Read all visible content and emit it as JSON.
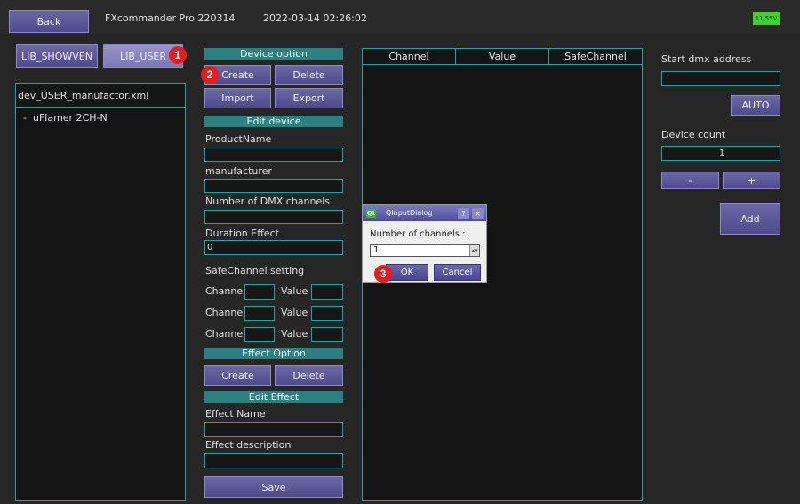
{
  "header": {
    "back": "Back",
    "app_title": "FXcommander Pro 220314",
    "datetime": "2022-03-14 02:26:02",
    "battery": "11.55V"
  },
  "left": {
    "tabs": [
      "LIB_SHOWVEN",
      "LIB_USER"
    ],
    "file": "dev_USER_manufactor.xml",
    "tree_items": [
      "uFlamer 2CH-N"
    ]
  },
  "device_option": {
    "header": "Device option",
    "create": "Create",
    "delete": "Delete",
    "import": "Import",
    "export": "Export"
  },
  "edit_device": {
    "header": "Edit device",
    "product_name_label": "ProductName",
    "product_name": "",
    "manufacturer_label": "manufacturer",
    "manufacturer": "",
    "dmx_channels_label": "Number of DMX channels",
    "dmx_channels": "",
    "duration_label": "Duration Effect",
    "duration": "0",
    "safe_label": "SafeChannel setting",
    "channel_label": "Channel",
    "value_label": "Value"
  },
  "effect_option": {
    "header": "Effect Option",
    "create": "Create",
    "delete": "Delete"
  },
  "edit_effect": {
    "header": "Edit Effect",
    "name_label": "Effect Name",
    "desc_label": "Effect description",
    "save": "Save"
  },
  "table": {
    "columns": [
      "Channel",
      "Value",
      "SafeChannel"
    ]
  },
  "right": {
    "start_label": "Start dmx address",
    "start_value": "",
    "auto": "AUTO",
    "count_label": "Device count",
    "count_value": "1",
    "minus": "-",
    "plus": "+",
    "add": "Add"
  },
  "dialog": {
    "title": "QInputDialog",
    "prompt": "Number of channels :",
    "value": "1",
    "ok": "OK",
    "cancel": "Cancel"
  },
  "badges": [
    "1",
    "2",
    "3"
  ]
}
